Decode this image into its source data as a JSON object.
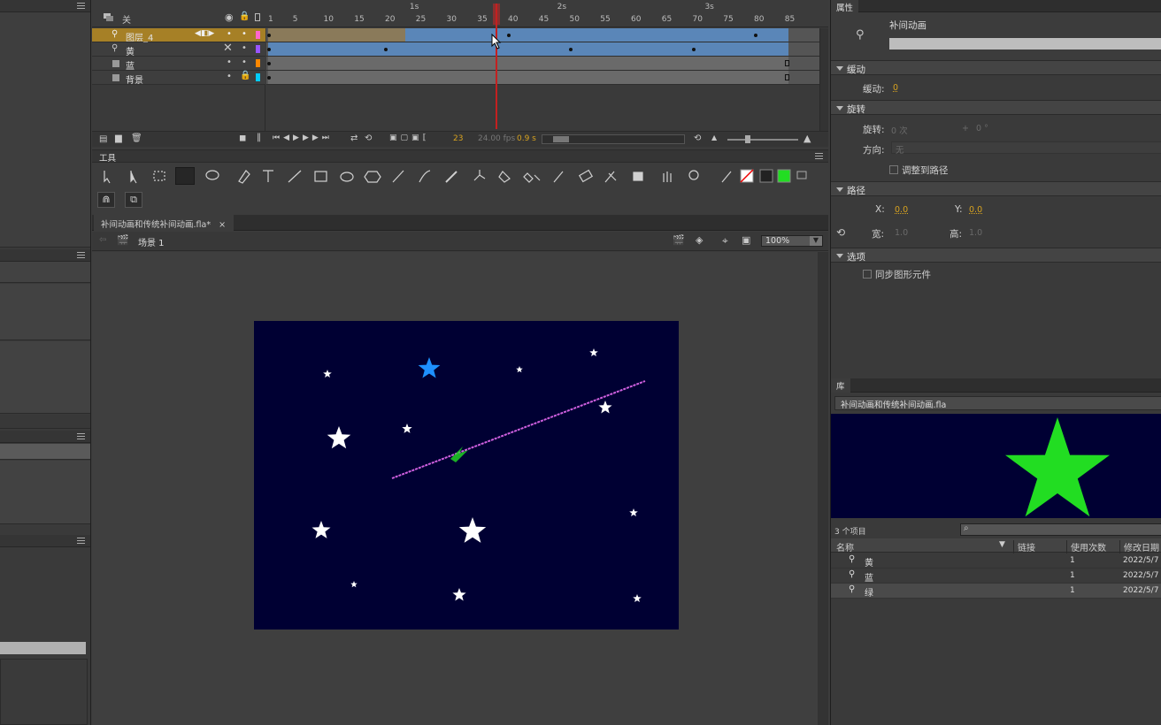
{
  "timeline": {
    "layers": [
      {
        "name": "关",
        "id": "header"
      },
      {
        "name": "图层_4"
      },
      {
        "name": "黄"
      },
      {
        "name": "蓝"
      },
      {
        "name": "背景"
      }
    ],
    "frame_ticks": [
      "1",
      "5",
      "10",
      "15",
      "20",
      "25",
      "30",
      "35",
      "40",
      "45",
      "50",
      "55",
      "60",
      "65",
      "70",
      "75",
      "80",
      "85"
    ],
    "seconds": [
      "1s",
      "2s",
      "3s"
    ],
    "footer": {
      "current_frame": "23",
      "fps": "24.00 fps",
      "time": "0.9 s"
    }
  },
  "tools_panel": {
    "title": "工具"
  },
  "document": {
    "tab_label": "补间动画和传统补间动画.fla*",
    "tab_close": "×",
    "scene": "场景 1",
    "zoom": "100%"
  },
  "properties": {
    "tab": "属性",
    "type": "补间动画",
    "ease_section": "缓动",
    "ease_label": "缓动:",
    "ease_value": "0",
    "rotate_section": "旋转",
    "rotate_label": "旋转:",
    "rotate_count": "0 次",
    "rotate_plus": "+",
    "rotate_deg": "0 °",
    "direction_label": "方向:",
    "direction_value": "无",
    "orient_label": "调整到路径",
    "path_section": "路径",
    "x_label": "X:",
    "x_value": "0.0",
    "y_label": "Y:",
    "y_value": "0.0",
    "w_label": "宽:",
    "w_value": "1.0",
    "h_label": "高:",
    "h_value": "1.0",
    "options_section": "选项",
    "sync_label": "同步图形元件"
  },
  "library": {
    "tab": "库",
    "file": "补间动画和传统补间动画.fla",
    "count": "3 个项目",
    "columns": [
      "名称",
      "链接",
      "使用次数",
      "修改日期"
    ],
    "items": [
      {
        "name": "黄",
        "uses": "1",
        "date": "2022/5/7"
      },
      {
        "name": "蓝",
        "uses": "1",
        "date": "2022/5/7"
      },
      {
        "name": "绿",
        "uses": "1",
        "date": "2022/5/7"
      }
    ]
  },
  "colors": {
    "stage_bg": "#000033",
    "star_white": "#ffffff",
    "star_blue": "#1e90ff",
    "star_green": "#22dd22",
    "path": "#d060e0",
    "selected_layer": "#a68026"
  }
}
